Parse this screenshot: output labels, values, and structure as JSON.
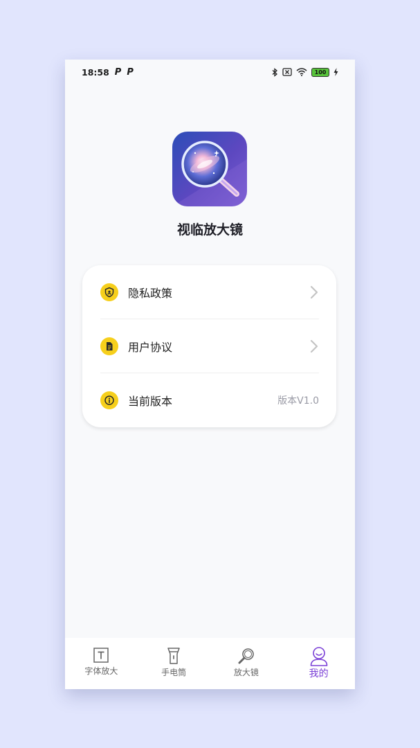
{
  "status_bar": {
    "time": "18:58",
    "notification_icons": [
      "P",
      "P"
    ],
    "battery_level": "100"
  },
  "app": {
    "name": "视临放大镜"
  },
  "menu": {
    "items": [
      {
        "label": "隐私政策",
        "icon": "shield-icon"
      },
      {
        "label": "用户协议",
        "icon": "document-icon"
      },
      {
        "label": "当前版本",
        "icon": "info-icon",
        "value": "版本V1.0"
      }
    ]
  },
  "tabbar": {
    "tabs": [
      {
        "label": "字体放大",
        "icon": "text-icon"
      },
      {
        "label": "手电筒",
        "icon": "flashlight-icon"
      },
      {
        "label": "放大镜",
        "icon": "magnifier-icon"
      },
      {
        "label": "我的",
        "icon": "profile-icon",
        "active": true
      }
    ]
  },
  "colors": {
    "accent": "#7a3fd6",
    "icon_yellow": "#f6cf1c",
    "background": "#e1e5fd"
  }
}
